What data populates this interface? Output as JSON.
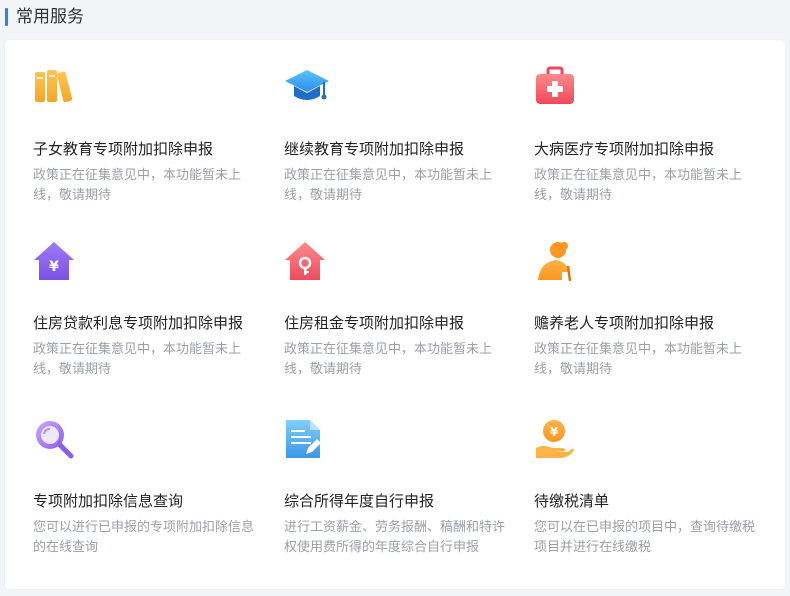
{
  "section": {
    "title": "常用服务"
  },
  "services": [
    {
      "icon": "books-icon",
      "name": "子女教育专项附加扣除申报",
      "desc": "政策正在征集意见中，本功能暂未上线，敬请期待"
    },
    {
      "icon": "graduation-cap-icon",
      "name": "继续教育专项附加扣除申报",
      "desc": "政策正在征集意见中，本功能暂未上线，敬请期待"
    },
    {
      "icon": "medical-kit-icon",
      "name": "大病医疗专项附加扣除申报",
      "desc": "政策正在征集意见中，本功能暂未上线，敬请期待"
    },
    {
      "icon": "house-loan-icon",
      "name": "住房贷款利息专项附加扣除申报",
      "desc": "政策正在征集意见中，本功能暂未上线，敬请期待"
    },
    {
      "icon": "house-key-icon",
      "name": "住房租金专项附加扣除申报",
      "desc": "政策正在征集意见中，本功能暂未上线，敬请期待"
    },
    {
      "icon": "elder-person-icon",
      "name": "赡养老人专项附加扣除申报",
      "desc": "政策正在征集意见中，本功能暂未上线，敬请期待"
    },
    {
      "icon": "magnifier-icon",
      "name": "专项附加扣除信息查询",
      "desc": "您可以进行已申报的专项附加扣除信息的在线查询"
    },
    {
      "icon": "document-edit-icon",
      "name": "综合所得年度自行申报",
      "desc": "进行工资薪金、劳务报酬、稿酬和特许权使用费所得的年度综合自行申报"
    },
    {
      "icon": "hand-coin-icon",
      "name": "待缴税清单",
      "desc": "您可以在已申报的项目中，查询待缴税项目并进行在线缴税"
    }
  ],
  "colors": {
    "accent": "#2f80ed",
    "text": "#222222",
    "desc": "#9aa0a6"
  }
}
